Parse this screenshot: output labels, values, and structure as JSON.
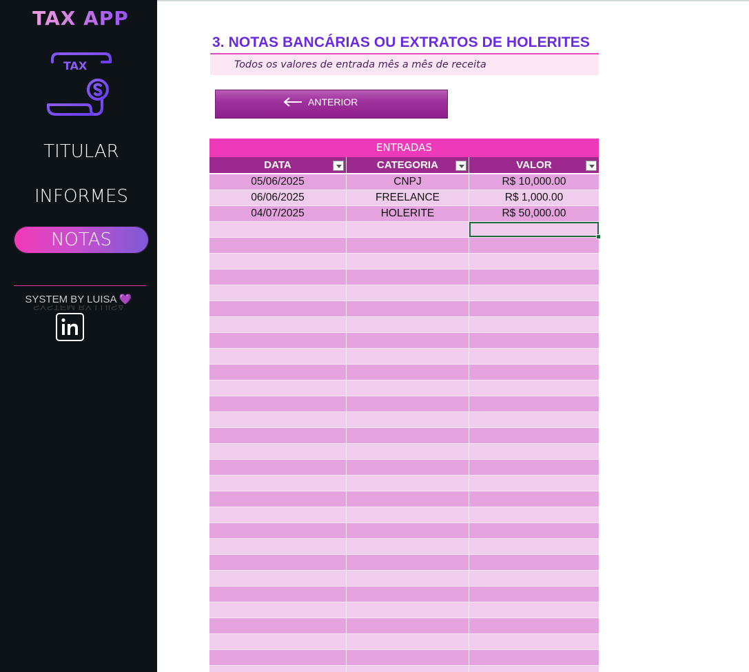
{
  "sidebar": {
    "app_title": "TAX APP",
    "logo_text": "TAX",
    "nav": [
      {
        "label": "TITULAR"
      },
      {
        "label": "INFORMES"
      },
      {
        "label": "NOTAS"
      }
    ],
    "active_index": 2,
    "credit": "SYSTEM BY LUISA",
    "credit_emoji": "💜",
    "social_icon": "linkedin-icon"
  },
  "page": {
    "title": "3. NOTAS BANCÁRIAS OU EXTRATOS DE HOLERITES",
    "subtitle": "Todos os valores de entrada mês a mês de receita",
    "prev_button": "ANTERIOR",
    "prev_icon": "arrow-left-icon"
  },
  "table": {
    "title": "ENTRADAS",
    "columns": [
      "DATA",
      "CATEGORIA",
      "VALOR"
    ],
    "rows": [
      [
        "05/06/2025",
        "CNPJ",
        "R$ 10,000.00"
      ],
      [
        "06/06/2025",
        "FREELANCE",
        "R$ 1,000.00"
      ],
      [
        "04/07/2025",
        "HOLERITE",
        "R$ 50,000.00"
      ]
    ],
    "empty_rows": 29
  },
  "colors": {
    "sidebar_bg": "#0e1317",
    "accent_pink": "#ee3ab8",
    "accent_purple": "#6a2ae0",
    "header_purple": "#9c2a8e",
    "row_dark": "#e4a3de",
    "row_light": "#f0cdec"
  }
}
